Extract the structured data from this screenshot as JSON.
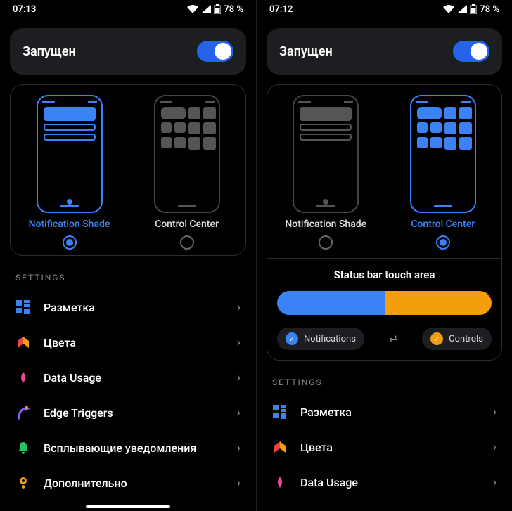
{
  "left": {
    "status": {
      "time": "07:13",
      "battery": "78 %"
    },
    "running_label": "Запущен",
    "options": {
      "notif": "Notification Shade",
      "control": "Control Center",
      "selected": "notif"
    },
    "settings_title": "SETTINGS",
    "items": [
      {
        "label": "Разметка"
      },
      {
        "label": "Цвета"
      },
      {
        "label": "Data Usage"
      },
      {
        "label": "Edge Triggers"
      },
      {
        "label": "Всплывающие уведомления"
      },
      {
        "label": "Дополнительно"
      }
    ]
  },
  "right": {
    "status": {
      "time": "07:12",
      "battery": "78 %"
    },
    "running_label": "Запущен",
    "options": {
      "notif": "Notification Shade",
      "control": "Control Center",
      "selected": "control"
    },
    "touch": {
      "title": "Status bar touch area",
      "left_label": "Notifications",
      "right_label": "Controls"
    },
    "settings_title": "SETTINGS",
    "items": [
      {
        "label": "Разметка"
      },
      {
        "label": "Цвета"
      },
      {
        "label": "Data Usage"
      }
    ]
  }
}
